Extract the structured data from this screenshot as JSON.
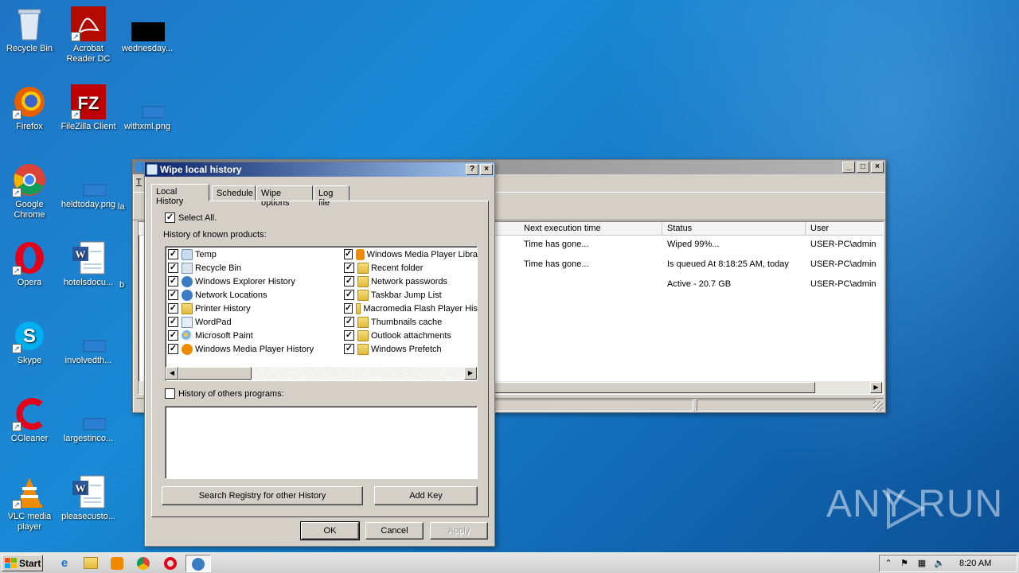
{
  "desktop": {
    "icons": [
      {
        "label": "Recycle Bin"
      },
      {
        "label": "Acrobat Reader DC"
      },
      {
        "label": "wednesday..."
      },
      {
        "label": "Firefox"
      },
      {
        "label": "FileZilla Client"
      },
      {
        "label": "withxml.png"
      },
      {
        "label": "Google Chrome"
      },
      {
        "label": "heldtoday.png"
      },
      {
        "label": "Opera"
      },
      {
        "label": "hotelsdocu..."
      },
      {
        "label": "Skype"
      },
      {
        "label": "involvedth..."
      },
      {
        "label": "CCleaner"
      },
      {
        "label": "largestinco..."
      },
      {
        "label": "VLC media player"
      },
      {
        "label": "pleasecusto..."
      }
    ],
    "partial_labels": [
      "la",
      "b"
    ]
  },
  "bg_window": {
    "menu_first": "T",
    "columns": [
      "Next execution time",
      "Status",
      "User"
    ],
    "rows": [
      {
        "next": "Time has gone...",
        "status": "Wiped 99%...",
        "user": "USER-PC\\admin"
      },
      {
        "next": "Time has gone...",
        "status": "Is queued At 8:18:25 AM, today",
        "user": "USER-PC\\admin"
      },
      {
        "next": "",
        "status": "Active - 20.7 GB",
        "user": "USER-PC\\admin"
      }
    ]
  },
  "dialog": {
    "title": "Wipe local history",
    "help_btn": "?",
    "close_btn": "×",
    "tabs": [
      "Local History",
      "Schedule",
      "Wipe options",
      "Log file"
    ],
    "select_all": "Select All.",
    "known_label": "History of known products:",
    "left_items": [
      "Temp",
      "Recycle Bin",
      "Windows Explorer History",
      "Network Locations",
      "Printer History",
      "WordPad",
      "Microsoft Paint",
      "Windows Media Player History"
    ],
    "right_items": [
      "Windows Media Player Libra",
      "Recent folder",
      "Network passwords",
      "Taskbar Jump List",
      "Macromedia Flash Player His",
      "Thumbnails cache",
      "Outlook attachments",
      "Windows Prefetch"
    ],
    "others_label": "History of others programs:",
    "search_btn": "Search Registry for other  History",
    "add_key_btn": "Add Key",
    "ok": "OK",
    "cancel": "Cancel",
    "apply": "Apply"
  },
  "taskbar": {
    "start": "Start",
    "clock": "8:20 AM"
  },
  "watermark": "ANY RUN"
}
